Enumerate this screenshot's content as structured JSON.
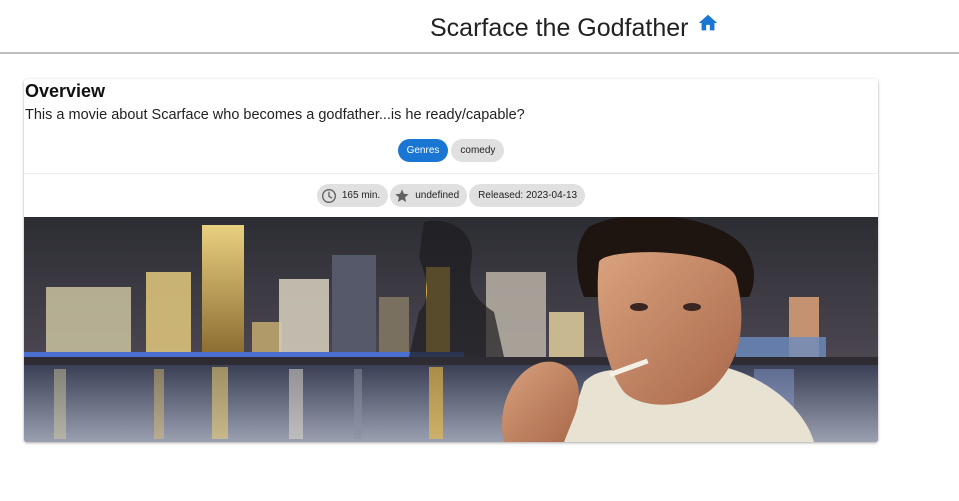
{
  "header": {
    "title": "Scarface the Godfather",
    "home_icon": "home-icon",
    "accent_color": "#1976d2"
  },
  "overview": {
    "heading": "Overview",
    "text": "This a movie about Scarface who becomes a godfather...is he ready/capable?"
  },
  "genres": {
    "label": "Genres",
    "items": [
      "comedy"
    ]
  },
  "meta": {
    "runtime": "165 min.",
    "runtime_icon": "clock-icon",
    "rating": "undefined",
    "rating_icon": "star-icon",
    "released": "Released: 2023-04-13"
  },
  "poster": {
    "image_description_icon": "movie-poster-image"
  }
}
